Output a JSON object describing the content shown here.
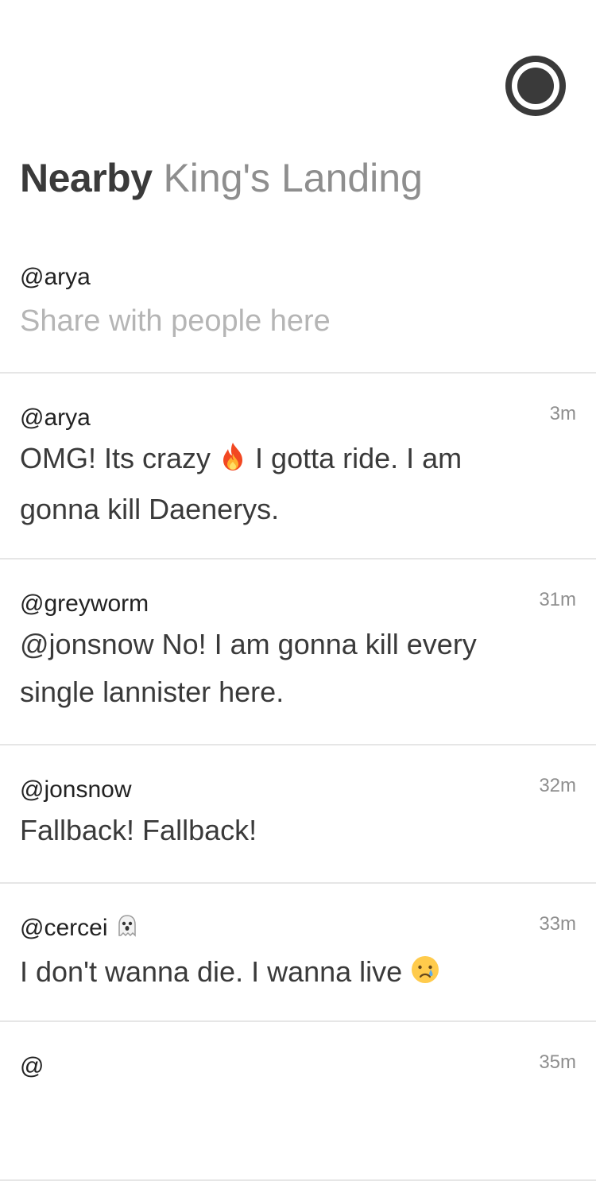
{
  "header": {
    "title": "Nearby",
    "location": "King's Landing",
    "profile_icon": "profile-ring-icon"
  },
  "composer": {
    "handle": "@arya",
    "placeholder": "Share with people here",
    "value": ""
  },
  "posts": [
    {
      "author": "@arya",
      "time": "3m",
      "text_before": "OMG! Its crazy",
      "emoji": "fire-emoji",
      "text_after": "I gotta ride. I am gonna kill Daenerys."
    },
    {
      "author": "@greyworm",
      "time": "31m",
      "text": "@jonsnow No! I am gonna kill every single lannister here."
    },
    {
      "author": "@jonsnow",
      "time": "32m",
      "text": "Fallback! Fallback!"
    },
    {
      "author": "@cercei",
      "author_emoji": "ghost-emoji",
      "time": "33m",
      "text": "I don't wanna die. I wanna live",
      "emoji": "crying-face-emoji"
    },
    {
      "author": "@",
      "time": "35m"
    }
  ]
}
